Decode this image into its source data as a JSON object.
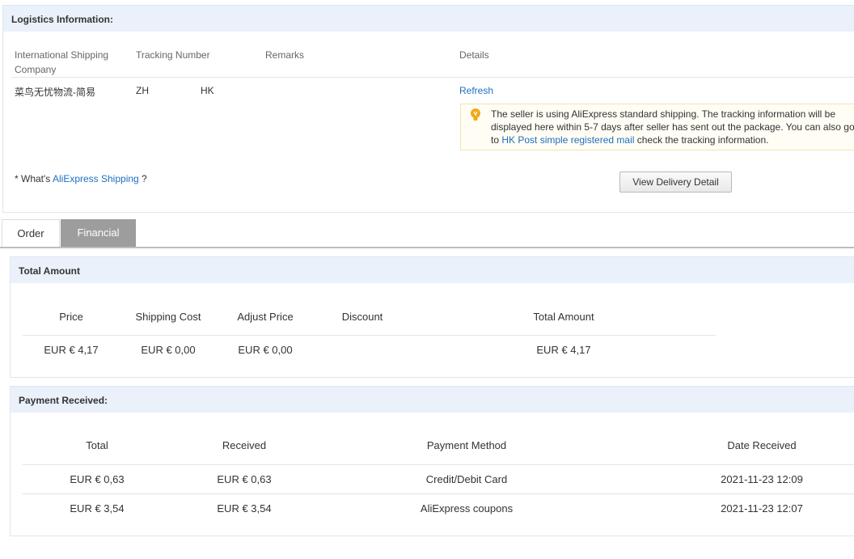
{
  "logistics": {
    "title": "Logistics Information:",
    "headers": {
      "company": "International Shipping Company",
      "tracking": "Tracking Number",
      "remarks": "Remarks",
      "details": "Details"
    },
    "row": {
      "company": "菜鸟无忧物流-简易",
      "tracking_prefix": "ZH",
      "tracking_suffix": "HK",
      "refresh": "Refresh"
    },
    "notice": {
      "text_before": "The seller is using AliExpress standard shipping. The tracking information will be displayed here within 5-7 days after seller has sent out the package. You can also go to ",
      "link": "HK Post simple registered mail",
      "text_after": " check the tracking information."
    },
    "whats_prefix": "* What's ",
    "whats_link": "AliExpress Shipping",
    "whats_suffix": " ?",
    "view_button": "View Delivery Detail"
  },
  "tabs": {
    "order": "Order",
    "financial": "Financial"
  },
  "total_amount": {
    "title": "Total Amount",
    "headers": [
      "Price",
      "Shipping Cost",
      "Adjust Price",
      "Discount",
      "Total Amount"
    ],
    "row": [
      "EUR € 4,17",
      "EUR € 0,00",
      "EUR € 0,00",
      "",
      "EUR € 4,17"
    ]
  },
  "payment": {
    "title": "Payment Received:",
    "headers": [
      "Total",
      "Received",
      "Payment Method",
      "Date Received"
    ],
    "rows": [
      [
        "EUR € 0,63",
        "EUR € 0,63",
        "Credit/Debit Card",
        "2021-11-23 12:09"
      ],
      [
        "EUR € 3,54",
        "EUR € 3,54",
        "AliExpress coupons",
        "2021-11-23 12:07"
      ]
    ]
  },
  "colors": {
    "link": "#1e6fbf",
    "header_bg": "#eaf1fb",
    "active_tab": "#9d9d9d",
    "notice_bg": "#fffdf4",
    "bulb": "#f2a918"
  },
  "icons": {
    "notice": "lightbulb-icon"
  }
}
